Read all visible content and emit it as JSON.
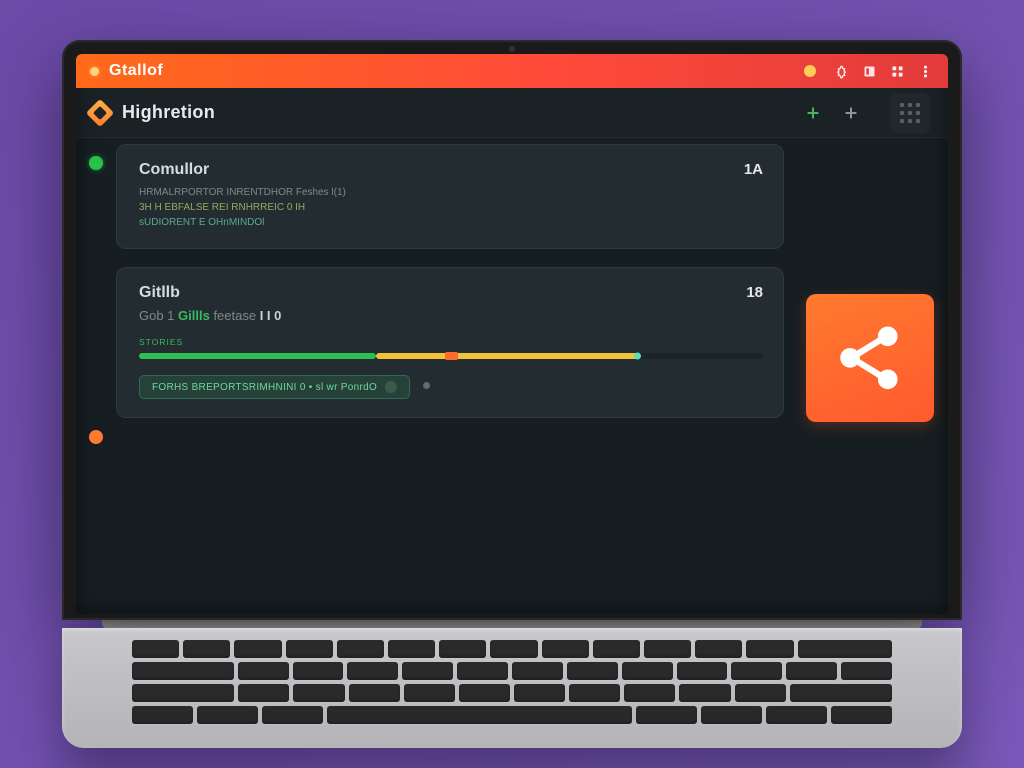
{
  "colors": {
    "accent_orange": "#ff6a2e",
    "accent_green": "#2fbf55",
    "accent_yellow": "#f2c23a",
    "bg_panel": "#232d31"
  },
  "titlebar": {
    "app_name": "Gtallof"
  },
  "section": {
    "title": "Highretion"
  },
  "cards": [
    {
      "title": "Comullor",
      "count": "1A",
      "lines": [
        "HRMALRPORTOR INRENTDHOR Feshes l(1)",
        "3H H EBFALSE REI RNHRREIC 0 IH",
        "sUDIORENT E OHnMINDOl"
      ]
    },
    {
      "title": "Gitllb",
      "count": "18",
      "subline_parts": [
        "Gob 1 ",
        "Gillls",
        " feetase ",
        "I I 0"
      ],
      "mini_label": "STORIES",
      "chip_text": "FORHS BREPORTSRIMHNINI 0 • sl wr PonrdO"
    }
  ]
}
